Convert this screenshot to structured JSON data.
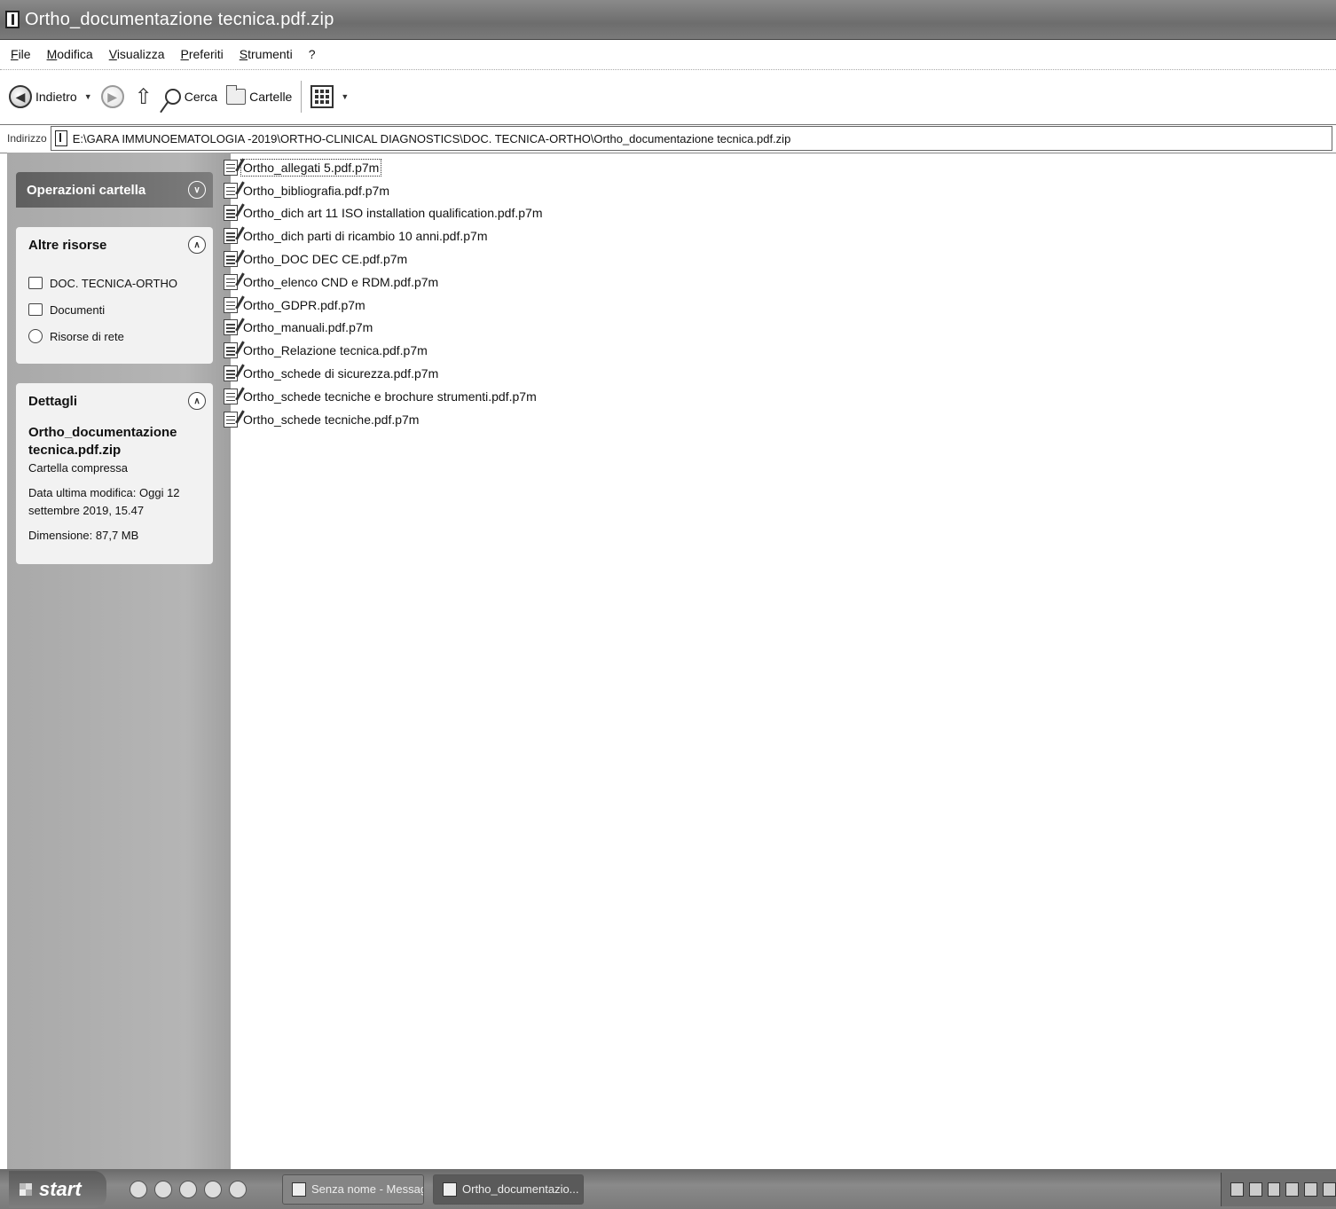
{
  "window": {
    "title": "Ortho_documentazione tecnica.pdf.zip"
  },
  "menu": [
    "File",
    "Modifica",
    "Visualizza",
    "Preferiti",
    "Strumenti",
    "?"
  ],
  "toolbar": {
    "back_label": "Indietro",
    "search_label": "Cerca",
    "folders_label": "Cartelle"
  },
  "address": {
    "label": "Indirizzo",
    "value": "E:\\GARA IMMUNOEMATOLOGIA -2019\\ORTHO-CLINICAL DIAGNOSTICS\\DOC. TECNICA-ORTHO\\Ortho_documentazione tecnica.pdf.zip"
  },
  "sidebar": {
    "folder_tasks_title": "Operazioni cartella",
    "other_resources_title": "Altre risorse",
    "other_resources": [
      {
        "label": "DOC. TECNICA-ORTHO",
        "icon": "folder-icon"
      },
      {
        "label": "Documenti",
        "icon": "documents-icon"
      },
      {
        "label": "Risorse di rete",
        "icon": "network-icon"
      }
    ],
    "details_title": "Dettagli",
    "details": {
      "name": "Ortho_documentazione tecnica.pdf.zip",
      "type": "Cartella compressa",
      "modified": "Data ultima modifica: Oggi 12 settembre 2019, 15.47",
      "size": "Dimensione: 87,7 MB"
    }
  },
  "files": [
    "Ortho_allegati 5.pdf.p7m",
    "Ortho_bibliografia.pdf.p7m",
    "Ortho_dich art 11 ISO installation qualification.pdf.p7m",
    "Ortho_dich parti di ricambio 10 anni.pdf.p7m",
    "Ortho_DOC DEC CE.pdf.p7m",
    "Ortho_elenco CND e RDM.pdf.p7m",
    "Ortho_GDPR.pdf.p7m",
    "Ortho_manuali.pdf.p7m",
    "Ortho_Relazione tecnica.pdf.p7m",
    "Ortho_schede di sicurezza.pdf.p7m",
    "Ortho_schede tecniche e brochure strumenti.pdf.p7m",
    "Ortho_schede tecniche.pdf.p7m"
  ],
  "taskbar": {
    "start_label": "start",
    "tasks": [
      "Senza nome - Messag...",
      "Ortho_documentazio..."
    ]
  }
}
